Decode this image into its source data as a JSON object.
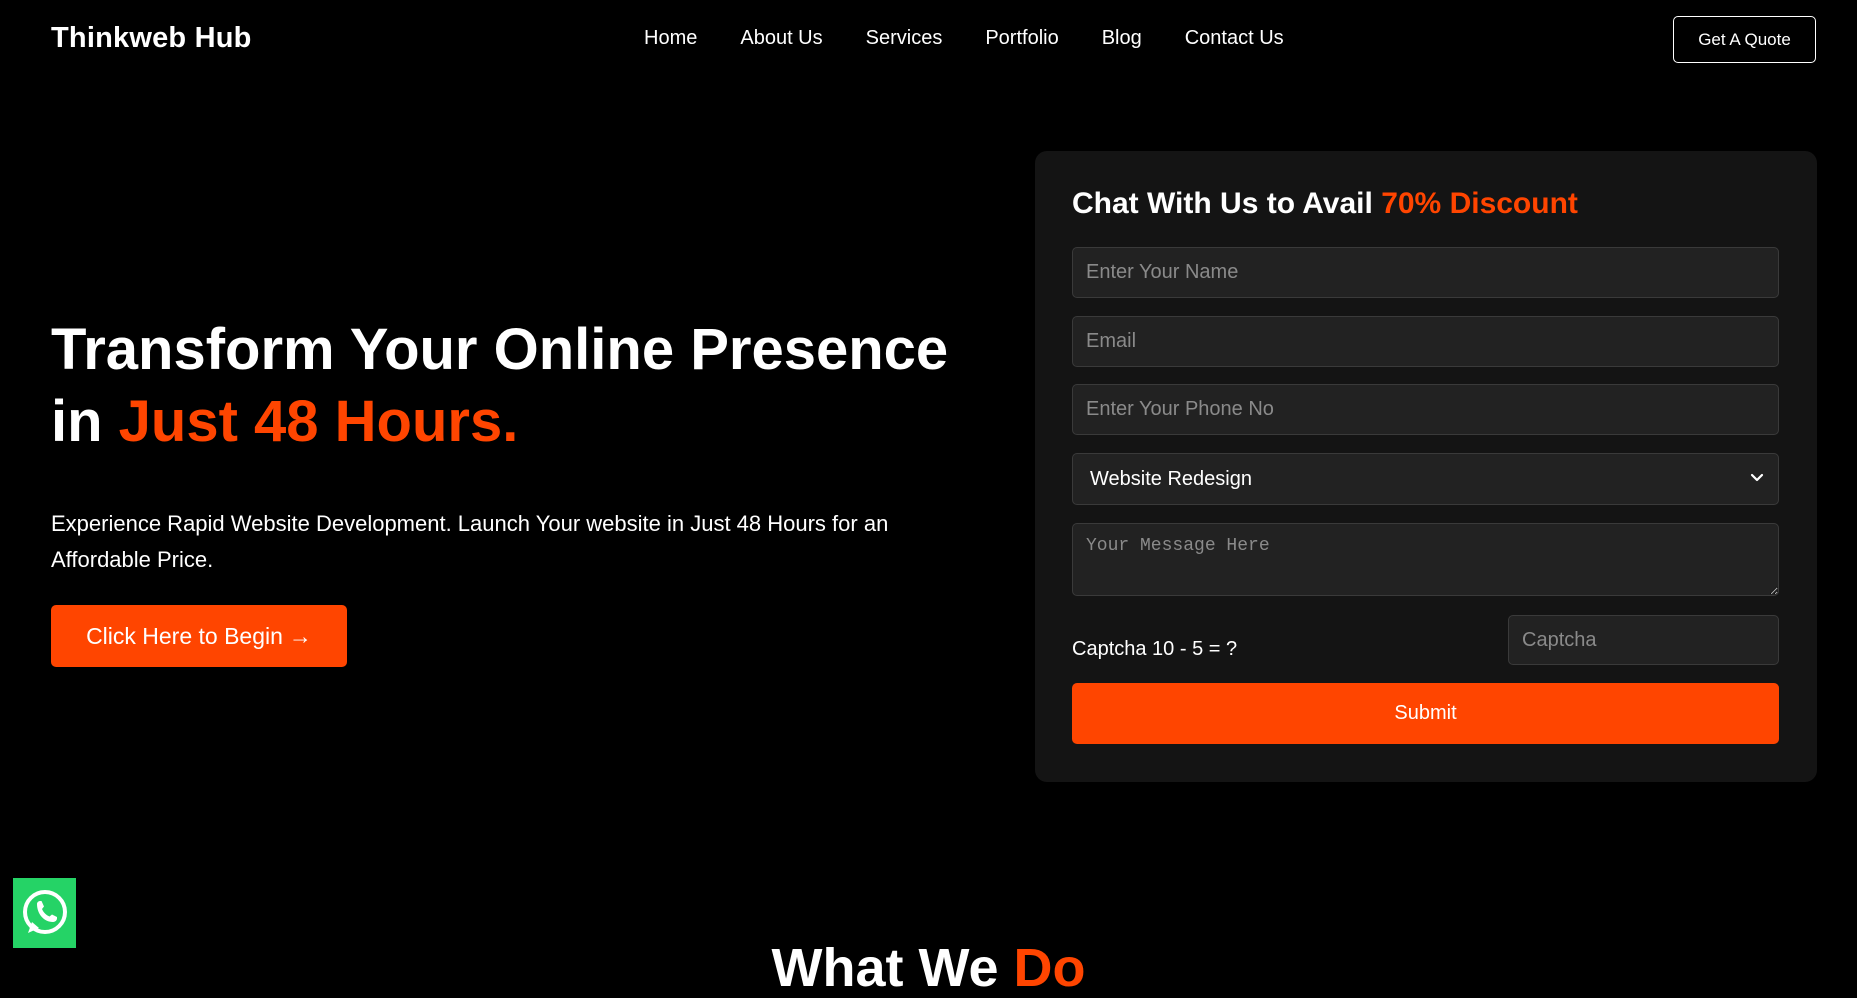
{
  "header": {
    "brand": "Thinkweb Hub",
    "nav": [
      "Home",
      "About Us",
      "Services",
      "Portfolio",
      "Blog",
      "Contact Us"
    ],
    "quote_button": "Get A Quote"
  },
  "hero": {
    "title_part1": "Transform Your Online Presence in ",
    "title_accent": "Just 48 Hours.",
    "description": "Experience Rapid Website Development. Launch Your website in Just 48 Hours for an Affordable Price.",
    "cta_label": "Click Here to Begin",
    "cta_arrow": "→"
  },
  "form": {
    "title_part1": "Chat With Us to Avail ",
    "title_accent": "70% Discount",
    "name_placeholder": "Enter Your Name",
    "email_placeholder": "Email",
    "phone_placeholder": "Enter Your Phone No",
    "service_selected": "Website Redesign",
    "message_placeholder": "Your Message Here",
    "captcha_label": "Captcha 10 - 5 = ?",
    "captcha_placeholder": "Captcha",
    "submit_label": "Submit"
  },
  "next_section": {
    "heading_part1": "What We ",
    "heading_accent": "Do"
  },
  "colors": {
    "accent": "#ff4500",
    "background": "#000000",
    "card": "#141414",
    "whatsapp": "#25d366"
  },
  "icons": {
    "select": "chevron-down-icon",
    "floating": "whatsapp-icon"
  }
}
